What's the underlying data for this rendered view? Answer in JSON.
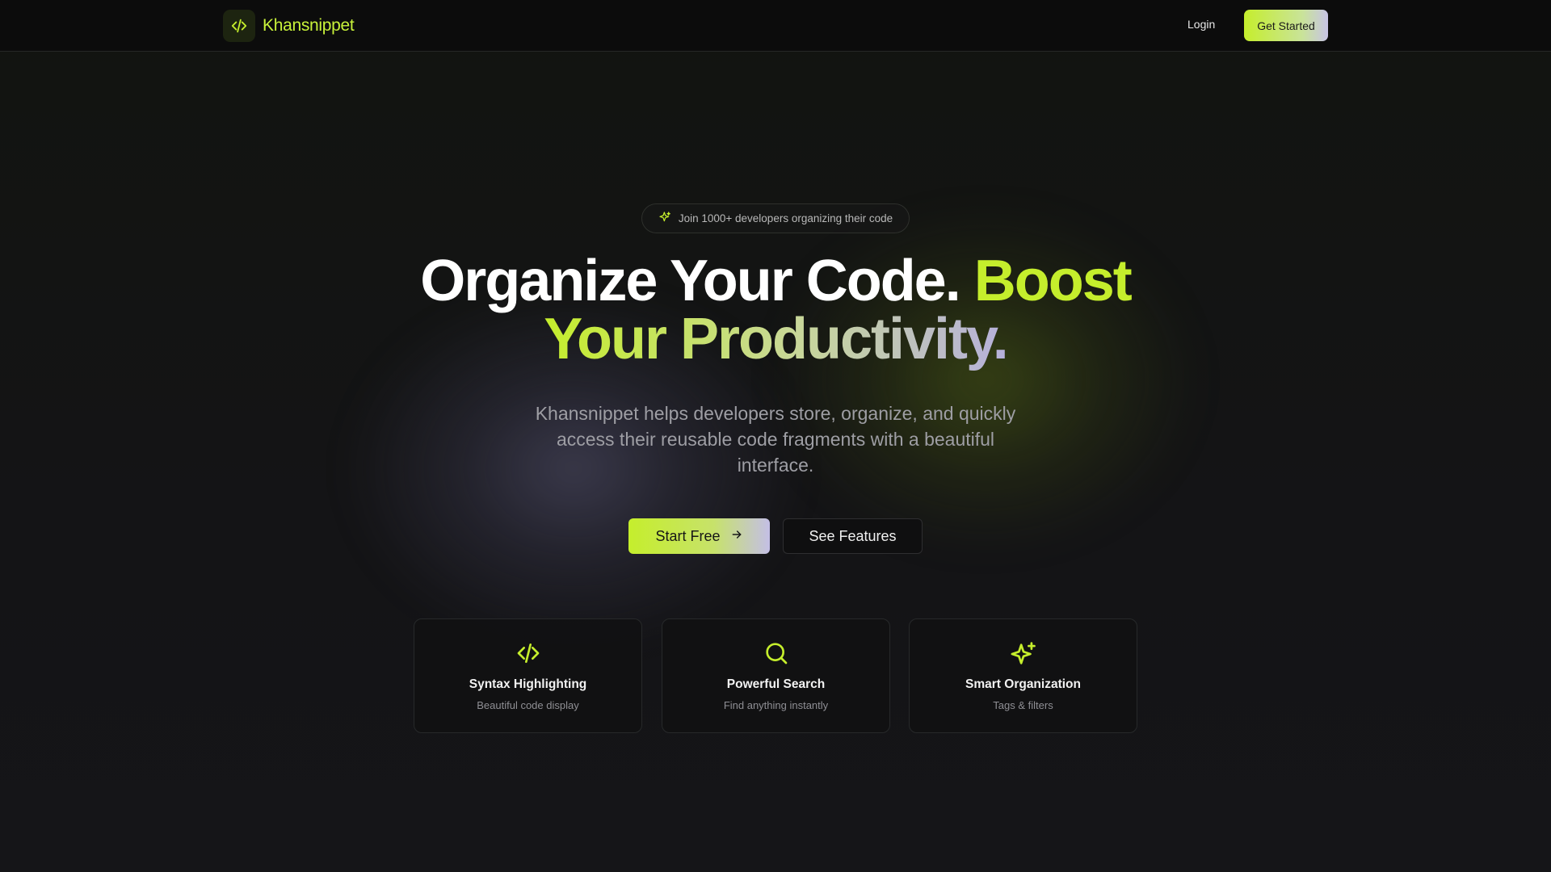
{
  "nav": {
    "brand": "Khansnippet",
    "login_label": "Login",
    "cta_label": "Get Started"
  },
  "hero": {
    "badge_text": "Join 1000+ developers organizing their code",
    "headline_part1": "Organize Your Code. ",
    "headline_accent": "Boost",
    "headline_line2": "Your Productivity.",
    "subtitle": "Khansnippet helps developers store, organize, and quickly access their reusable code fragments with a beautiful interface.",
    "primary_button": "Start Free",
    "secondary_button": "See Features"
  },
  "features": [
    {
      "icon": "code-icon",
      "title": "Syntax Highlighting",
      "description": "Beautiful code display"
    },
    {
      "icon": "search-icon",
      "title": "Powerful Search",
      "description": "Find anything instantly"
    },
    {
      "icon": "sparkles-icon",
      "title": "Smart Organization",
      "description": "Tags & filters"
    }
  ],
  "colors": {
    "accent": "#c5ee2c",
    "background": "#131316",
    "lavender": "#b6b0dc"
  }
}
